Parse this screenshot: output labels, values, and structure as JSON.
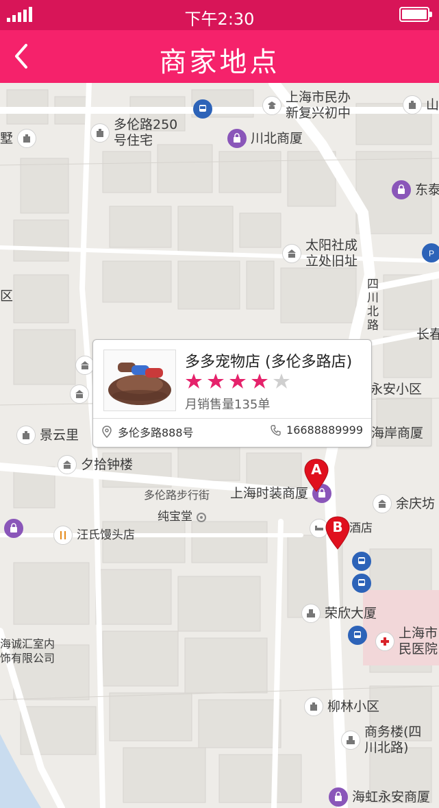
{
  "status": {
    "time": "下午2:30"
  },
  "nav": {
    "title": "商家地点"
  },
  "map": {
    "pois": [
      {
        "label": "上海市民办\n新复兴初中",
        "icon": "school-icon"
      },
      {
        "label": "山",
        "icon": "landmark-icon"
      },
      {
        "label": "多伦路250\n号住宅",
        "icon": "landmark-icon"
      },
      {
        "label": "川北商厦",
        "icon": "shopping-icon"
      },
      {
        "label": "墅",
        "icon": "landmark-icon"
      },
      {
        "label": "东泰",
        "icon": "shopping-icon"
      },
      {
        "label": "太阳社成\n立处旧址",
        "icon": "landmark-icon"
      },
      {
        "label": "区",
        "icon": "none"
      },
      {
        "label": "四\n川\n北\n路",
        "icon": "none"
      },
      {
        "label": "长春",
        "icon": "none"
      },
      {
        "label": "永安小区",
        "icon": "none"
      },
      {
        "label": "景云里",
        "icon": "landmark-icon"
      },
      {
        "label": "海岸商厦",
        "icon": "none"
      },
      {
        "label": "夕拾钟楼",
        "icon": "landmark-icon"
      },
      {
        "label": "上海时装商厦",
        "icon": "shopping-icon"
      },
      {
        "label": "余庆坊",
        "icon": "landmark-icon"
      },
      {
        "label": "纯宝堂",
        "icon": "dot-icon"
      },
      {
        "label": "汪氏馒头店",
        "icon": "food-icon"
      },
      {
        "label": "酒店",
        "icon": "hotel-icon"
      },
      {
        "label": "荣欣大厦",
        "icon": "building-icon"
      },
      {
        "label": "上海市\n民医院",
        "icon": "hospital-icon"
      },
      {
        "label": "海诚汇室内\n饰有限公司",
        "icon": "none"
      },
      {
        "label": "柳林小区",
        "icon": "landmark-icon"
      },
      {
        "label": "商务楼(四\n川北路)",
        "icon": "building-icon"
      },
      {
        "label": "海虹永安商厦",
        "icon": "shopping-icon"
      }
    ],
    "road_labels": [
      "多伦路步行街"
    ],
    "markers": [
      "A",
      "B"
    ]
  },
  "store": {
    "name": "多多宠物店 (多伦多路店)",
    "rating": 4,
    "max_rating": 5,
    "sales": "月销售量135单",
    "address": "多伦多路888号",
    "phone": "16688889999"
  },
  "colors": {
    "statusbar": "#d81558",
    "navbar": "#f5226b",
    "star_active": "#e5226b",
    "star_inactive": "#cfcfcf",
    "marker": "#e0101e"
  }
}
